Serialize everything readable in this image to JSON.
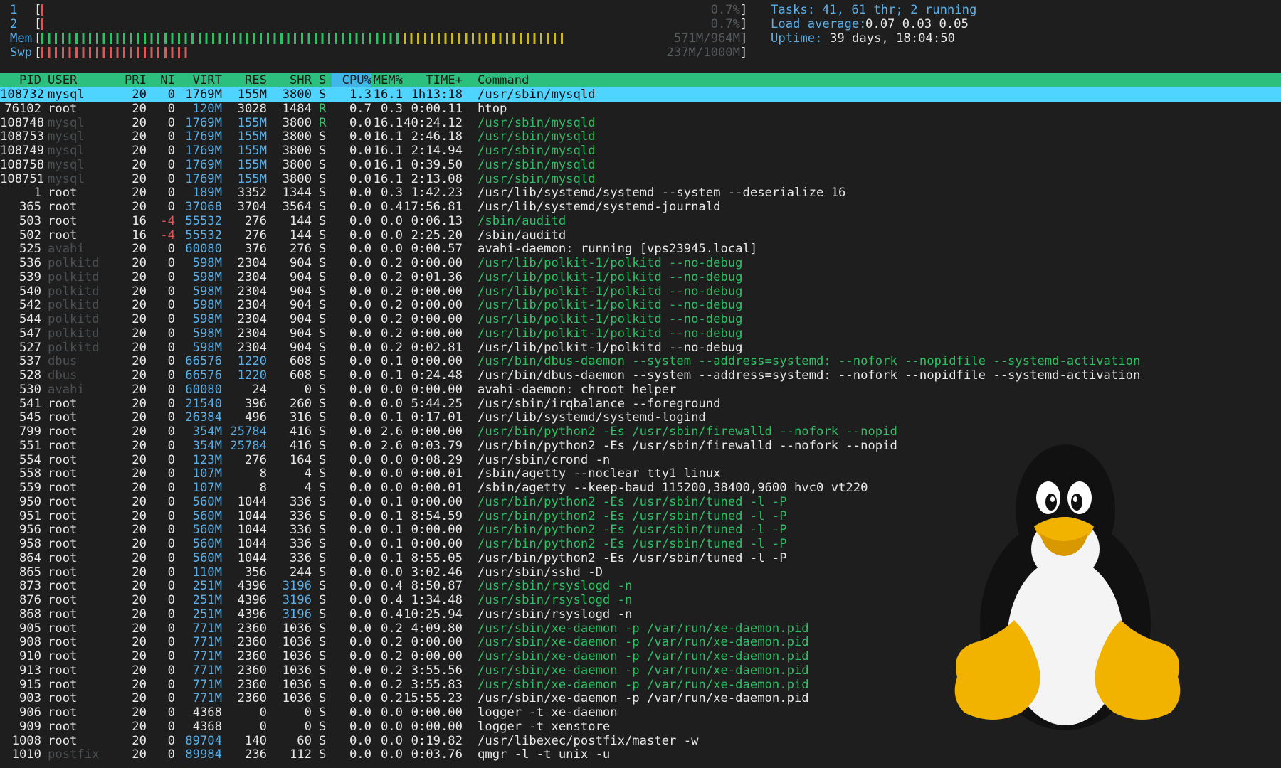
{
  "meters": {
    "cpu1": {
      "label": "1",
      "value": "0.7%",
      "fill": 0.007,
      "color": "#d65a5a"
    },
    "cpu2": {
      "label": "2",
      "value": "0.7%",
      "fill": 0.007,
      "color": "#d65a5a"
    },
    "mem": {
      "label": "Mem",
      "value": "571M/964M",
      "green_fill": 0.59,
      "yellow_fill": 0.26
    },
    "swp": {
      "label": "Swp",
      "value": "237M/1000M",
      "fill": 0.24,
      "color": "#d65a5a"
    }
  },
  "info": {
    "tasks_key": "Tasks:",
    "tasks_val": "41, 61 thr; 2 running",
    "load_key": "Load average:",
    "load_val": "0.07 0.03 0.05",
    "uptime_key": "Uptime:",
    "uptime_val": "39 days, 18:04:50"
  },
  "columns": {
    "pid": "PID",
    "user": "USER",
    "pri": "PRI",
    "ni": "NI",
    "virt": "VIRT",
    "res": "RES",
    "shr": "SHR",
    "s": "S",
    "cpu": "CPU%",
    "mem": "MEM%",
    "time": "TIME+",
    "command": "Command"
  },
  "colors": {
    "header_bg": "#2dbf7d",
    "sort_col_bg": "#3fb7e9",
    "selected_bg": "#4fd3ff",
    "thread_cmd": "#2fbf64",
    "highlight_num": "#5bb0e8"
  },
  "rows": [
    {
      "pid": "108732",
      "user": "mysql",
      "pri": "20",
      "ni": "0",
      "virt": "1769M",
      "res": "155M",
      "shr": "3800",
      "s": "S",
      "cpu": "1.3",
      "mem": "16.1",
      "time": "1h13:18",
      "cmd": "/usr/sbin/mysqld",
      "selected": true
    },
    {
      "pid": "76102",
      "user": "root",
      "pri": "20",
      "ni": "0",
      "virt": "120M",
      "res": "3028",
      "shr": "1484",
      "s": "R",
      "cpu": "0.7",
      "mem": "0.3",
      "time": "0:00.11",
      "cmd": "htop"
    },
    {
      "pid": "108748",
      "user": "mysql",
      "udim": true,
      "pri": "20",
      "ni": "0",
      "virt": "1769M",
      "res": "155M",
      "shr": "3800",
      "s": "R",
      "cpu": "0.0",
      "mem": "16.1",
      "time": "40:24.12",
      "cmd": "/usr/sbin/mysqld",
      "thread": true
    },
    {
      "pid": "108753",
      "user": "mysql",
      "udim": true,
      "pri": "20",
      "ni": "0",
      "virt": "1769M",
      "res": "155M",
      "shr": "3800",
      "s": "S",
      "cpu": "0.0",
      "mem": "16.1",
      "time": "2:46.18",
      "cmd": "/usr/sbin/mysqld",
      "thread": true
    },
    {
      "pid": "108749",
      "user": "mysql",
      "udim": true,
      "pri": "20",
      "ni": "0",
      "virt": "1769M",
      "res": "155M",
      "shr": "3800",
      "s": "S",
      "cpu": "0.0",
      "mem": "16.1",
      "time": "2:14.94",
      "cmd": "/usr/sbin/mysqld",
      "thread": true
    },
    {
      "pid": "108758",
      "user": "mysql",
      "udim": true,
      "pri": "20",
      "ni": "0",
      "virt": "1769M",
      "res": "155M",
      "shr": "3800",
      "s": "S",
      "cpu": "0.0",
      "mem": "16.1",
      "time": "0:39.50",
      "cmd": "/usr/sbin/mysqld",
      "thread": true
    },
    {
      "pid": "108751",
      "user": "mysql",
      "udim": true,
      "pri": "20",
      "ni": "0",
      "virt": "1769M",
      "res": "155M",
      "shr": "3800",
      "s": "S",
      "cpu": "0.0",
      "mem": "16.1",
      "time": "2:13.08",
      "cmd": "/usr/sbin/mysqld",
      "thread": true
    },
    {
      "pid": "1",
      "user": "root",
      "pri": "20",
      "ni": "0",
      "virt": "189M",
      "res": "3352",
      "shr": "1344",
      "s": "S",
      "cpu": "0.0",
      "mem": "0.3",
      "time": "1:42.23",
      "cmd": "/usr/lib/systemd/systemd --system --deserialize 16"
    },
    {
      "pid": "365",
      "user": "root",
      "pri": "20",
      "ni": "0",
      "virt": "37068",
      "res": "3704",
      "shr": "3564",
      "s": "S",
      "cpu": "0.0",
      "mem": "0.4",
      "time": "17:56.81",
      "cmd": "/usr/lib/systemd/systemd-journald"
    },
    {
      "pid": "503",
      "user": "root",
      "pri": "16",
      "ni": "-4",
      "nired": true,
      "virt": "55532",
      "res": "276",
      "shr": "144",
      "s": "S",
      "cpu": "0.0",
      "mem": "0.0",
      "time": "0:06.13",
      "cmd": "/sbin/auditd",
      "thread": true
    },
    {
      "pid": "502",
      "user": "root",
      "pri": "16",
      "ni": "-4",
      "nired": true,
      "virt": "55532",
      "res": "276",
      "shr": "144",
      "s": "S",
      "cpu": "0.0",
      "mem": "0.0",
      "time": "2:25.20",
      "cmd": "/sbin/auditd"
    },
    {
      "pid": "525",
      "user": "avahi",
      "udim": true,
      "pri": "20",
      "ni": "0",
      "virt": "60080",
      "res": "376",
      "shr": "276",
      "s": "S",
      "cpu": "0.0",
      "mem": "0.0",
      "time": "0:00.57",
      "cmd": "avahi-daemon: running [vps23945.local]"
    },
    {
      "pid": "536",
      "user": "polkitd",
      "udim": true,
      "pri": "20",
      "ni": "0",
      "virt": "598M",
      "res": "2304",
      "shr": "904",
      "s": "S",
      "cpu": "0.0",
      "mem": "0.2",
      "time": "0:00.00",
      "cmd": "/usr/lib/polkit-1/polkitd --no-debug",
      "thread": true
    },
    {
      "pid": "539",
      "user": "polkitd",
      "udim": true,
      "pri": "20",
      "ni": "0",
      "virt": "598M",
      "res": "2304",
      "shr": "904",
      "s": "S",
      "cpu": "0.0",
      "mem": "0.2",
      "time": "0:01.36",
      "cmd": "/usr/lib/polkit-1/polkitd --no-debug",
      "thread": true
    },
    {
      "pid": "540",
      "user": "polkitd",
      "udim": true,
      "pri": "20",
      "ni": "0",
      "virt": "598M",
      "res": "2304",
      "shr": "904",
      "s": "S",
      "cpu": "0.0",
      "mem": "0.2",
      "time": "0:00.00",
      "cmd": "/usr/lib/polkit-1/polkitd --no-debug",
      "thread": true
    },
    {
      "pid": "542",
      "user": "polkitd",
      "udim": true,
      "pri": "20",
      "ni": "0",
      "virt": "598M",
      "res": "2304",
      "shr": "904",
      "s": "S",
      "cpu": "0.0",
      "mem": "0.2",
      "time": "0:00.00",
      "cmd": "/usr/lib/polkit-1/polkitd --no-debug",
      "thread": true
    },
    {
      "pid": "544",
      "user": "polkitd",
      "udim": true,
      "pri": "20",
      "ni": "0",
      "virt": "598M",
      "res": "2304",
      "shr": "904",
      "s": "S",
      "cpu": "0.0",
      "mem": "0.2",
      "time": "0:00.00",
      "cmd": "/usr/lib/polkit-1/polkitd --no-debug",
      "thread": true
    },
    {
      "pid": "547",
      "user": "polkitd",
      "udim": true,
      "pri": "20",
      "ni": "0",
      "virt": "598M",
      "res": "2304",
      "shr": "904",
      "s": "S",
      "cpu": "0.0",
      "mem": "0.2",
      "time": "0:00.00",
      "cmd": "/usr/lib/polkit-1/polkitd --no-debug",
      "thread": true
    },
    {
      "pid": "527",
      "user": "polkitd",
      "udim": true,
      "pri": "20",
      "ni": "0",
      "virt": "598M",
      "res": "2304",
      "shr": "904",
      "s": "S",
      "cpu": "0.0",
      "mem": "0.2",
      "time": "0:02.81",
      "cmd": "/usr/lib/polkit-1/polkitd --no-debug"
    },
    {
      "pid": "537",
      "user": "dbus",
      "udim": true,
      "pri": "20",
      "ni": "0",
      "virt": "66576",
      "res": "1220",
      "shr": "608",
      "s": "S",
      "cpu": "0.0",
      "mem": "0.1",
      "time": "0:00.00",
      "cmd": "/usr/bin/dbus-daemon --system --address=systemd: --nofork --nopidfile --systemd-activation",
      "thread": true
    },
    {
      "pid": "528",
      "user": "dbus",
      "udim": true,
      "pri": "20",
      "ni": "0",
      "virt": "66576",
      "res": "1220",
      "shr": "608",
      "s": "S",
      "cpu": "0.0",
      "mem": "0.1",
      "time": "0:24.48",
      "cmd": "/usr/bin/dbus-daemon --system --address=systemd: --nofork --nopidfile --systemd-activation"
    },
    {
      "pid": "530",
      "user": "avahi",
      "udim": true,
      "pri": "20",
      "ni": "0",
      "virt": "60080",
      "res": "24",
      "shr": "0",
      "s": "S",
      "cpu": "0.0",
      "mem": "0.0",
      "time": "0:00.00",
      "cmd": "avahi-daemon: chroot helper"
    },
    {
      "pid": "541",
      "user": "root",
      "pri": "20",
      "ni": "0",
      "virt": "21540",
      "res": "396",
      "shr": "260",
      "s": "S",
      "cpu": "0.0",
      "mem": "0.0",
      "time": "5:44.25",
      "cmd": "/usr/sbin/irqbalance --foreground"
    },
    {
      "pid": "545",
      "user": "root",
      "pri": "20",
      "ni": "0",
      "virt": "26384",
      "res": "496",
      "shr": "316",
      "s": "S",
      "cpu": "0.0",
      "mem": "0.1",
      "time": "0:17.01",
      "cmd": "/usr/lib/systemd/systemd-logind"
    },
    {
      "pid": "799",
      "user": "root",
      "pri": "20",
      "ni": "0",
      "virt": "354M",
      "res": "25784",
      "shr": "416",
      "s": "S",
      "cpu": "0.0",
      "mem": "2.6",
      "time": "0:00.00",
      "cmd": "/usr/bin/python2 -Es /usr/sbin/firewalld --nofork --nopid",
      "thread": true
    },
    {
      "pid": "551",
      "user": "root",
      "pri": "20",
      "ni": "0",
      "virt": "354M",
      "res": "25784",
      "shr": "416",
      "s": "S",
      "cpu": "0.0",
      "mem": "2.6",
      "time": "0:03.79",
      "cmd": "/usr/bin/python2 -Es /usr/sbin/firewalld --nofork --nopid"
    },
    {
      "pid": "554",
      "user": "root",
      "pri": "20",
      "ni": "0",
      "virt": "123M",
      "res": "276",
      "shr": "164",
      "s": "S",
      "cpu": "0.0",
      "mem": "0.0",
      "time": "0:08.29",
      "cmd": "/usr/sbin/crond -n"
    },
    {
      "pid": "558",
      "user": "root",
      "pri": "20",
      "ni": "0",
      "virt": "107M",
      "res": "8",
      "shr": "4",
      "s": "S",
      "cpu": "0.0",
      "mem": "0.0",
      "time": "0:00.01",
      "cmd": "/sbin/agetty --noclear tty1 linux"
    },
    {
      "pid": "559",
      "user": "root",
      "pri": "20",
      "ni": "0",
      "virt": "107M",
      "res": "8",
      "shr": "4",
      "s": "S",
      "cpu": "0.0",
      "mem": "0.0",
      "time": "0:00.01",
      "cmd": "/sbin/agetty --keep-baud 115200,38400,9600 hvc0 vt220"
    },
    {
      "pid": "950",
      "user": "root",
      "pri": "20",
      "ni": "0",
      "virt": "560M",
      "res": "1044",
      "shr": "336",
      "s": "S",
      "cpu": "0.0",
      "mem": "0.1",
      "time": "0:00.00",
      "cmd": "/usr/bin/python2 -Es /usr/sbin/tuned -l -P",
      "thread": true
    },
    {
      "pid": "951",
      "user": "root",
      "pri": "20",
      "ni": "0",
      "virt": "560M",
      "res": "1044",
      "shr": "336",
      "s": "S",
      "cpu": "0.0",
      "mem": "0.1",
      "time": "8:54.59",
      "cmd": "/usr/bin/python2 -Es /usr/sbin/tuned -l -P",
      "thread": true
    },
    {
      "pid": "956",
      "user": "root",
      "pri": "20",
      "ni": "0",
      "virt": "560M",
      "res": "1044",
      "shr": "336",
      "s": "S",
      "cpu": "0.0",
      "mem": "0.1",
      "time": "0:00.00",
      "cmd": "/usr/bin/python2 -Es /usr/sbin/tuned -l -P",
      "thread": true
    },
    {
      "pid": "958",
      "user": "root",
      "pri": "20",
      "ni": "0",
      "virt": "560M",
      "res": "1044",
      "shr": "336",
      "s": "S",
      "cpu": "0.0",
      "mem": "0.1",
      "time": "0:00.00",
      "cmd": "/usr/bin/python2 -Es /usr/sbin/tuned -l -P",
      "thread": true
    },
    {
      "pid": "864",
      "user": "root",
      "pri": "20",
      "ni": "0",
      "virt": "560M",
      "res": "1044",
      "shr": "336",
      "s": "S",
      "cpu": "0.0",
      "mem": "0.1",
      "time": "8:55.05",
      "cmd": "/usr/bin/python2 -Es /usr/sbin/tuned -l -P"
    },
    {
      "pid": "865",
      "user": "root",
      "pri": "20",
      "ni": "0",
      "virt": "110M",
      "res": "356",
      "shr": "244",
      "s": "S",
      "cpu": "0.0",
      "mem": "0.0",
      "time": "3:02.46",
      "cmd": "/usr/sbin/sshd -D"
    },
    {
      "pid": "873",
      "user": "root",
      "pri": "20",
      "ni": "0",
      "virt": "251M",
      "res": "4396",
      "shr": "3196",
      "s": "S",
      "cpu": "0.0",
      "mem": "0.4",
      "time": "8:50.87",
      "cmd": "/usr/sbin/rsyslogd -n",
      "thread": true
    },
    {
      "pid": "876",
      "user": "root",
      "pri": "20",
      "ni": "0",
      "virt": "251M",
      "res": "4396",
      "shr": "3196",
      "s": "S",
      "cpu": "0.0",
      "mem": "0.4",
      "time": "1:34.48",
      "cmd": "/usr/sbin/rsyslogd -n",
      "thread": true
    },
    {
      "pid": "868",
      "user": "root",
      "pri": "20",
      "ni": "0",
      "virt": "251M",
      "res": "4396",
      "shr": "3196",
      "s": "S",
      "cpu": "0.0",
      "mem": "0.4",
      "time": "10:25.94",
      "cmd": "/usr/sbin/rsyslogd -n"
    },
    {
      "pid": "905",
      "user": "root",
      "pri": "20",
      "ni": "0",
      "virt": "771M",
      "res": "2360",
      "shr": "1036",
      "s": "S",
      "cpu": "0.0",
      "mem": "0.2",
      "time": "4:09.80",
      "cmd": "/usr/sbin/xe-daemon -p /var/run/xe-daemon.pid",
      "thread": true
    },
    {
      "pid": "908",
      "user": "root",
      "pri": "20",
      "ni": "0",
      "virt": "771M",
      "res": "2360",
      "shr": "1036",
      "s": "S",
      "cpu": "0.0",
      "mem": "0.2",
      "time": "0:00.00",
      "cmd": "/usr/sbin/xe-daemon -p /var/run/xe-daemon.pid",
      "thread": true
    },
    {
      "pid": "910",
      "user": "root",
      "pri": "20",
      "ni": "0",
      "virt": "771M",
      "res": "2360",
      "shr": "1036",
      "s": "S",
      "cpu": "0.0",
      "mem": "0.2",
      "time": "0:00.00",
      "cmd": "/usr/sbin/xe-daemon -p /var/run/xe-daemon.pid",
      "thread": true
    },
    {
      "pid": "913",
      "user": "root",
      "pri": "20",
      "ni": "0",
      "virt": "771M",
      "res": "2360",
      "shr": "1036",
      "s": "S",
      "cpu": "0.0",
      "mem": "0.2",
      "time": "3:55.56",
      "cmd": "/usr/sbin/xe-daemon -p /var/run/xe-daemon.pid",
      "thread": true
    },
    {
      "pid": "915",
      "user": "root",
      "pri": "20",
      "ni": "0",
      "virt": "771M",
      "res": "2360",
      "shr": "1036",
      "s": "S",
      "cpu": "0.0",
      "mem": "0.2",
      "time": "3:55.83",
      "cmd": "/usr/sbin/xe-daemon -p /var/run/xe-daemon.pid",
      "thread": true
    },
    {
      "pid": "903",
      "user": "root",
      "pri": "20",
      "ni": "0",
      "virt": "771M",
      "res": "2360",
      "shr": "1036",
      "s": "S",
      "cpu": "0.0",
      "mem": "0.2",
      "time": "15:55.23",
      "cmd": "/usr/sbin/xe-daemon -p /var/run/xe-daemon.pid"
    },
    {
      "pid": "906",
      "user": "root",
      "pri": "20",
      "ni": "0",
      "virt": "4368",
      "res": "0",
      "shr": "0",
      "s": "S",
      "cpu": "0.0",
      "mem": "0.0",
      "time": "0:00.00",
      "cmd": "logger -t xe-daemon"
    },
    {
      "pid": "909",
      "user": "root",
      "pri": "20",
      "ni": "0",
      "virt": "4368",
      "res": "0",
      "shr": "0",
      "s": "S",
      "cpu": "0.0",
      "mem": "0.0",
      "time": "0:00.00",
      "cmd": "logger -t xenstore"
    },
    {
      "pid": "1008",
      "user": "root",
      "pri": "20",
      "ni": "0",
      "virt": "89704",
      "res": "140",
      "shr": "60",
      "s": "S",
      "cpu": "0.0",
      "mem": "0.0",
      "time": "0:19.82",
      "cmd": "/usr/libexec/postfix/master -w"
    },
    {
      "pid": "1010",
      "user": "postfix",
      "udim": true,
      "pri": "20",
      "ni": "0",
      "virt": "89984",
      "res": "236",
      "shr": "112",
      "s": "S",
      "cpu": "0.0",
      "mem": "0.0",
      "time": "0:03.76",
      "cmd": "qmgr -l -t unix -u"
    }
  ],
  "mascot": {
    "icon": "tux-penguin-icon"
  }
}
